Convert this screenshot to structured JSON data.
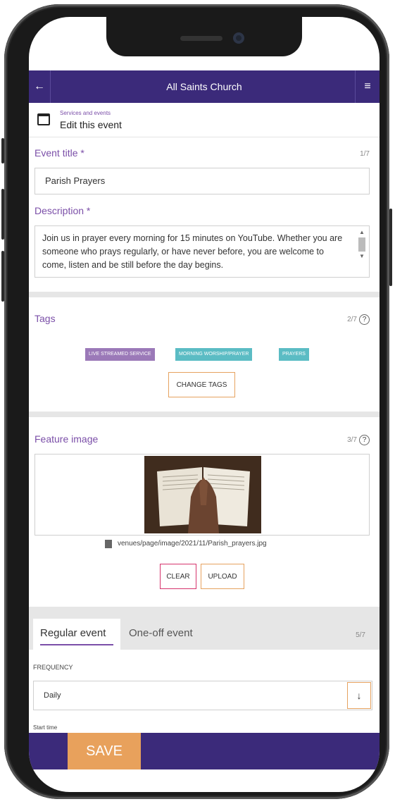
{
  "app": {
    "title": "All Saints Church"
  },
  "header": {
    "crumb_small": "Services and events",
    "crumb_main": "Edit this event"
  },
  "event_title": {
    "label": "Event title *",
    "counter": "1/7",
    "value": "Parish Prayers"
  },
  "description": {
    "label": "Description *",
    "value": "Join us in prayer every morning for 15 minutes on YouTube. Whether you are someone who prays regularly, or have never before, you are welcome to come, listen and be still before the day begins."
  },
  "tags": {
    "label": "Tags",
    "counter": "2/7",
    "items": [
      {
        "label": "LIVE STREAMED SERVICE",
        "color": "#9b79b8"
      },
      {
        "label": "MORNING WORSHIP/PRAYER",
        "color": "#5bbcc4"
      },
      {
        "label": "PRAYERS",
        "color": "#5bbcc4"
      }
    ],
    "change_label": "CHANGE TAGS"
  },
  "feature_image": {
    "label": "Feature image",
    "counter": "3/7",
    "file_path": "venues/page/image/2021/11/Parish_prayers.jpg",
    "clear_label": "CLEAR",
    "upload_label": "UPLOAD"
  },
  "schedule": {
    "tab_regular": "Regular event",
    "tab_oneoff": "One-off event",
    "counter": "5/7",
    "frequency_label": "FREQUENCY",
    "frequency_value": "Daily",
    "start_time_label": "Start time"
  },
  "footer": {
    "save_label": "SAVE"
  },
  "colors": {
    "brand": "#3b2a7a",
    "accent": "#e8a15c",
    "label": "#7b4fa8"
  }
}
